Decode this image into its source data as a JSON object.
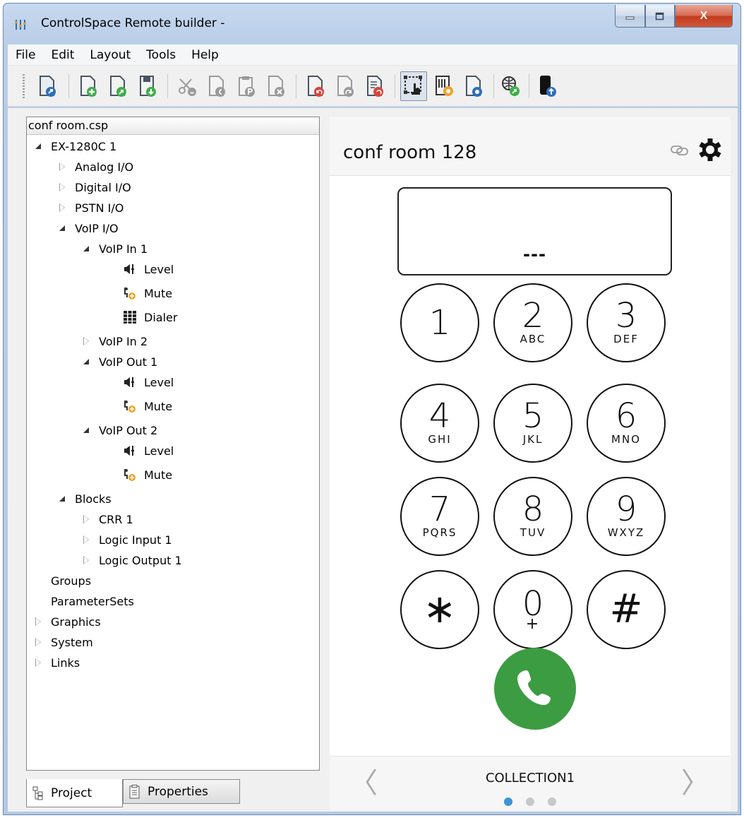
{
  "window": {
    "title": "ControlSpace Remote builder -",
    "min_glyph": "▁",
    "max_glyph": "☐",
    "close_glyph": "X"
  },
  "menu": [
    "File",
    "Edit",
    "Layout",
    "Tools",
    "Help"
  ],
  "toolbar": {
    "buttons": [
      "open-remote",
      "new",
      "open",
      "save",
      "cut",
      "copy",
      "paste",
      "delete",
      "revert",
      "redo",
      "reload",
      "layout-edit",
      "dialer-settings",
      "device-settings",
      "web-export",
      "phone-upload"
    ],
    "active": "layout-edit"
  },
  "tree": {
    "file": "conf room.csp",
    "nodes": [
      {
        "label": "EX-1280C 1",
        "state": "open",
        "depth": 0
      },
      {
        "label": "Analog I/O",
        "state": "closed",
        "depth": 1
      },
      {
        "label": "Digital I/O",
        "state": "closed",
        "depth": 1
      },
      {
        "label": "PSTN I/O",
        "state": "closed",
        "depth": 1
      },
      {
        "label": "VoIP I/O",
        "state": "open",
        "depth": 1
      },
      {
        "label": "VoIP In 1",
        "state": "open",
        "depth": 2
      },
      {
        "label": "Level",
        "state": "leaf",
        "icon": "speaker-level-icon",
        "depth": 3
      },
      {
        "label": "Mute",
        "state": "leaf",
        "icon": "mute-icon",
        "depth": 3
      },
      {
        "label": "Dialer",
        "state": "leaf",
        "icon": "keypad-icon",
        "depth": 3
      },
      {
        "label": "VoIP In 2",
        "state": "closed",
        "depth": 2
      },
      {
        "label": "VoIP Out 1",
        "state": "open",
        "depth": 2
      },
      {
        "label": "Level",
        "state": "leaf",
        "icon": "speaker-level-icon",
        "depth": 3
      },
      {
        "label": "Mute",
        "state": "leaf",
        "icon": "mute-icon",
        "depth": 3
      },
      {
        "label": "VoIP Out 2",
        "state": "open",
        "depth": 2
      },
      {
        "label": "Level",
        "state": "leaf",
        "icon": "speaker-level-icon",
        "depth": 3
      },
      {
        "label": "Mute",
        "state": "leaf",
        "icon": "mute-icon",
        "depth": 3
      },
      {
        "label": "Blocks",
        "state": "open",
        "depth": 1
      },
      {
        "label": "CRR 1",
        "state": "closed",
        "depth": 2
      },
      {
        "label": "Logic Input 1",
        "state": "closed",
        "depth": 2
      },
      {
        "label": "Logic Output 1",
        "state": "closed",
        "depth": 2
      },
      {
        "label": "Groups",
        "state": "none",
        "depth": 0
      },
      {
        "label": "ParameterSets",
        "state": "none",
        "depth": 0
      },
      {
        "label": "Graphics",
        "state": "closed",
        "depth": 0
      },
      {
        "label": "System",
        "state": "closed",
        "depth": 0
      },
      {
        "label": "Links",
        "state": "closed",
        "depth": 0
      }
    ]
  },
  "bottom_tabs": {
    "project": "Project",
    "properties": "Properties"
  },
  "phone": {
    "title": "conf room 128",
    "display_value": "---",
    "keys": [
      {
        "digit": "1",
        "letters": ""
      },
      {
        "digit": "2",
        "letters": "ABC"
      },
      {
        "digit": "3",
        "letters": "DEF"
      },
      {
        "digit": "4",
        "letters": "GHI"
      },
      {
        "digit": "5",
        "letters": "JKL"
      },
      {
        "digit": "6",
        "letters": "MNO"
      },
      {
        "digit": "7",
        "letters": "PQRS"
      },
      {
        "digit": "8",
        "letters": "TUV"
      },
      {
        "digit": "9",
        "letters": "WXYZ"
      },
      {
        "digit": "∗",
        "letters": ""
      },
      {
        "digit": "0",
        "letters": "+"
      },
      {
        "digit": "#",
        "letters": ""
      }
    ],
    "collection": "COLLECTION1",
    "prev_arrow": "〈",
    "next_arrow": "〉",
    "page_count": 3,
    "active_page": 1,
    "call_color": "#3c9c42",
    "accent": "#3b95d4"
  }
}
